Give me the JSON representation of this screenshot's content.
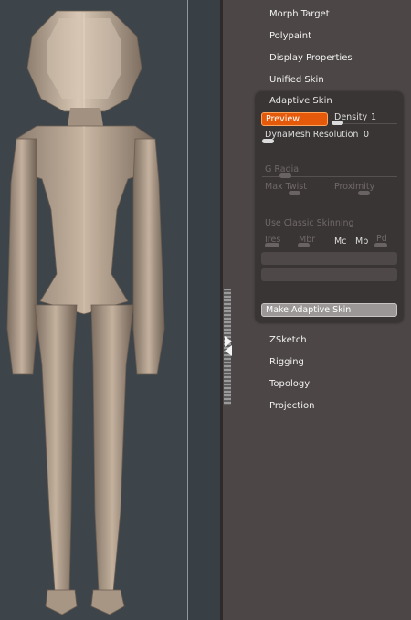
{
  "menu": {
    "items_top": [
      "Morph Target",
      "Polypaint",
      "Display Properties",
      "Unified Skin"
    ],
    "items_bottom": [
      "ZSketch",
      "Rigging",
      "Topology",
      "Projection"
    ]
  },
  "adaptive_skin": {
    "title": "Adaptive Skin",
    "preview_label": "Preview",
    "density_label": "Density",
    "density_value": "1",
    "dynamesh_label": "DynaMesh Resolution",
    "dynamesh_value": "0",
    "g_radial_label": "G Radial",
    "max_twist_label": "Max Twist",
    "proximity_label": "Proximity",
    "classic_label": "Use Classic Skinning",
    "ires_label": "Ires",
    "mbr_label": "Mbr",
    "mc_label": "Mc",
    "mp_label": "Mp",
    "pd_label": "Pd",
    "make_label": "Make Adaptive Skin"
  },
  "colors": {
    "accent": "#e55a0a",
    "tray": "#4c4646",
    "viewport": "#3d454a",
    "model": "#b9a795"
  },
  "icons": [
    "tray-expand-arrow-icon",
    "tray-collapse-arrow-icon"
  ]
}
